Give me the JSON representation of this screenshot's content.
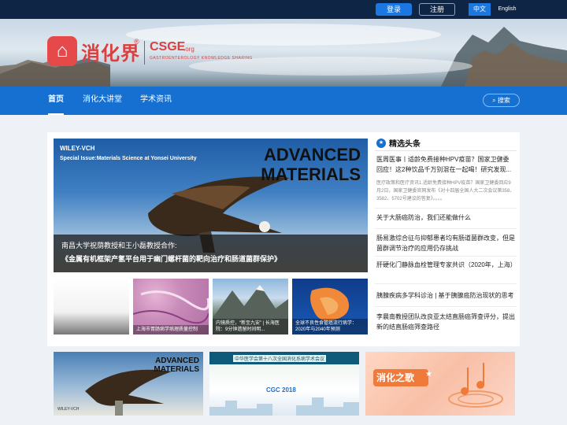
{
  "topbar": {
    "login": "登录",
    "register": "注册",
    "lang_zh": "中文",
    "lang_en": "English"
  },
  "banner": {
    "logo_cn": "消化界",
    "logo_reg": "®",
    "logo_en": "CSGE",
    "logo_org": ".org",
    "logo_sub": "GASTROENTEROLOGY KNOWLEDGE SHARING"
  },
  "nav": {
    "items": [
      "首页",
      "消化大讲堂",
      "学术资讯"
    ],
    "search": "搜索"
  },
  "hero": {
    "brand": "WILEY-VCH",
    "issue": "Special Issue:Materials Science at Yonsei University",
    "journal": "ADVANCED MATERIALS",
    "caption_line1": "南昌大学祝荫教授和王小磊教授合作:",
    "caption_line2": "《金属有机框架产氢平台用于幽门螺杆菌的靶向治疗和肠道菌群保护》"
  },
  "thumbs": [
    {
      "caption": ""
    },
    {
      "caption": "上海市胃肠病学病理质量控制"
    },
    {
      "caption": "内镜质控，“新至九安” | 长海医院：9分钟遗留时间明..."
    },
    {
      "caption": "全球不良性食管癌流行病学：2020年与2040年预测"
    }
  ],
  "sidebar": {
    "title": "精选头条",
    "featured_title": "医周医事丨适龄免费接种HPV疫苗？国家卫健委回应！这2种饮品千万别混在一起喝！研究发现...",
    "featured_desc": "医疗政策和医疗资讯1.适龄免费接种HPV疫苗？国家卫健委回应9月2日，国家卫健委官网发布《对十四届全国人大二次会议第358、3582、5702号建议的答复》。。。。",
    "news": [
      "关于大肠癌防治，我们还能做什么",
      "肠易激综合征与抑郁患者均有肠道菌群改变，但是菌群调节治疗的应用仍存挑战",
      "肝硬化门静脉血栓管理专家共识（2020年，上海）",
      "胰腺疾病多学科诊治 | 基于胰腺癌防治现状的思考",
      "李晨南教授团队改良亚太结直肠癌筛查评分，提出新的结直肠癌筛查路径"
    ]
  },
  "ads": [
    {
      "title": "ADVANCED MATERIALS",
      "brand": "WILEY-VCH"
    },
    {
      "title": "中华医学会第十八次全国消化系病学术会议",
      "sub": "CGC 2018"
    },
    {
      "title": "消化之歌",
      "star": "★"
    }
  ]
}
